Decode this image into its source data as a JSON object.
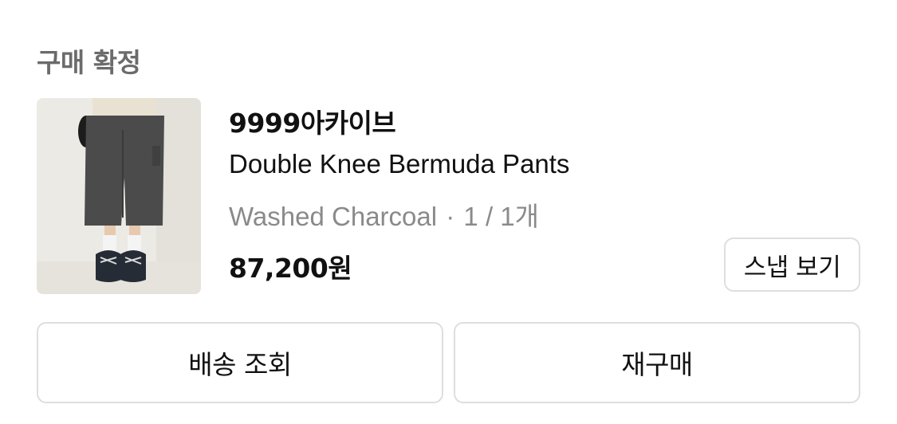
{
  "order": {
    "status": "구매 확정"
  },
  "product": {
    "brand": "9999아카이브",
    "name": "Double Knee Bermuda Pants",
    "color": "Washed Charcoal",
    "separator": "·",
    "quantity": "1 / 1개",
    "price": "87,200원",
    "image_description_name": "product-photo"
  },
  "buttons": {
    "snap": "스냅 보기",
    "track_delivery": "배송 조회",
    "rebuy": "재구매"
  },
  "colors": {
    "status_gray": "#6b6b6b",
    "option_gray": "#8a8a8a",
    "border": "#dedede"
  }
}
